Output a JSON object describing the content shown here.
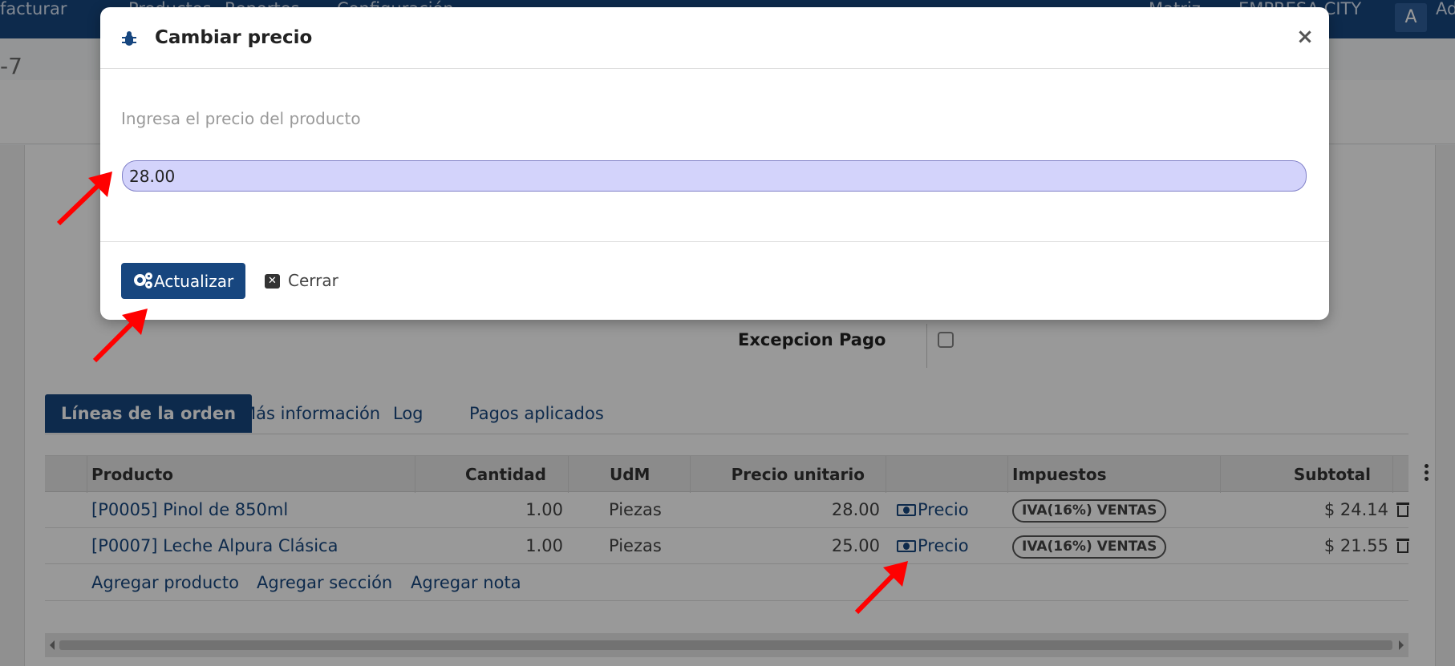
{
  "topbar": {
    "nav": [
      "facturar",
      "Productos",
      "Reportes",
      "Configuración"
    ],
    "company_switch": "Matriz",
    "company": "EMPRESA CITY",
    "user_initial": "A",
    "user_name": "Ad"
  },
  "breadcrumb_tail": "-7",
  "form": {
    "excepcion_pago_label": "Excepcion Pago",
    "excepcion_pago_checked": false
  },
  "tabs": [
    {
      "label": "Líneas de la orden",
      "active": true
    },
    {
      "label": "Más información",
      "active": false
    },
    {
      "label": "Log",
      "active": false
    },
    {
      "label": "Pagos aplicados",
      "active": false
    }
  ],
  "table": {
    "columns": [
      "Producto",
      "Cantidad",
      "UdM",
      "Precio unitario",
      "Impuestos",
      "Subtotal"
    ],
    "rows": [
      {
        "producto": "[P0005] Pinol de 850ml",
        "cantidad": "1.00",
        "udm": "Piezas",
        "precio_unitario": "28.00",
        "precio_button": "Precio",
        "impuesto": "IVA(16%) VENTAS",
        "subtotal": "$ 24.14"
      },
      {
        "producto": "[P0007] Leche Alpura Clásica",
        "cantidad": "1.00",
        "udm": "Piezas",
        "precio_unitario": "25.00",
        "precio_button": "Precio",
        "impuesto": "IVA(16%) VENTAS",
        "subtotal": "$ 21.55"
      }
    ],
    "add_links": [
      "Agregar producto",
      "Agregar sección",
      "Agregar nota"
    ]
  },
  "modal": {
    "title": "Cambiar precio",
    "close_symbol": "×",
    "prompt": "Ingresa el precio del producto",
    "price_value": "28.00",
    "update_label": "Actualizar",
    "cancel_label": "Cerrar"
  },
  "colors": {
    "brand": "#17467f",
    "input_bg": "#d3d3fb",
    "annotation_arrow": "#ff0000"
  }
}
